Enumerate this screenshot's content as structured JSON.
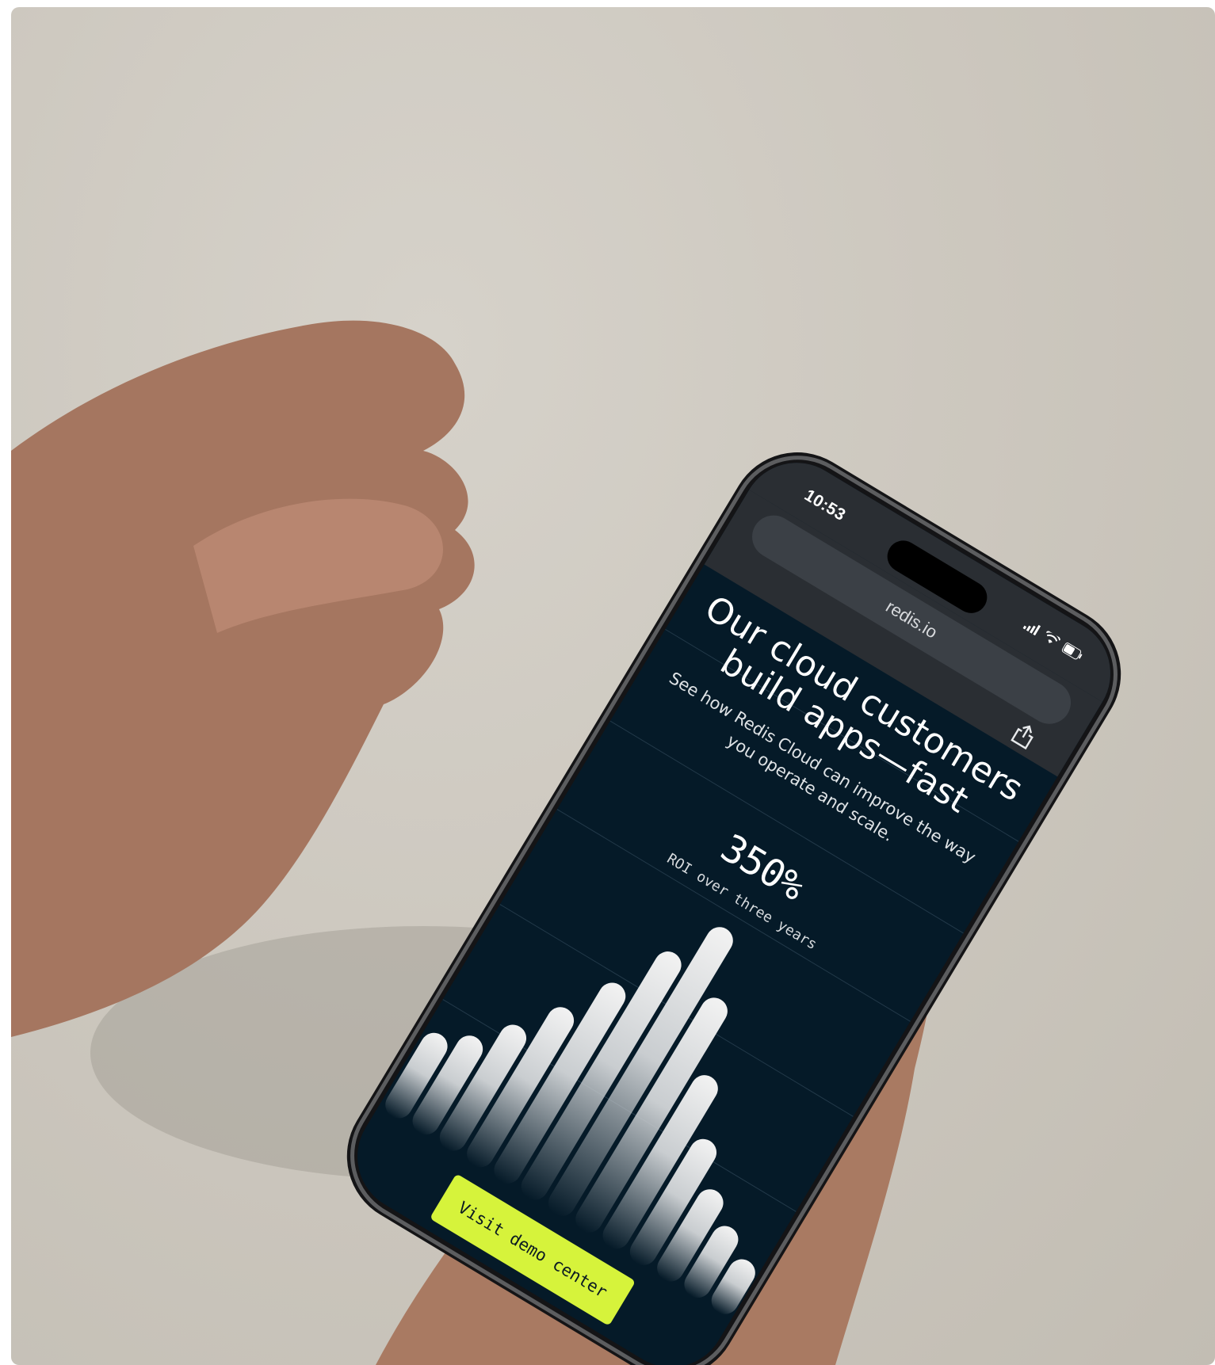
{
  "status_bar": {
    "time": "10:53",
    "icons": [
      "signal-icon",
      "wifi-icon",
      "battery-icon"
    ]
  },
  "browser": {
    "url": "redis.io",
    "share_icon": "share-icon"
  },
  "hero": {
    "title": "Our cloud customers build apps—fast",
    "subtitle": "See how Redis Cloud can improve the way you operate and scale."
  },
  "stat": {
    "value": "350%",
    "label": "ROI over three years"
  },
  "cta": {
    "label": "Visit demo center"
  },
  "colors": {
    "screen_background": "#051a28",
    "cta_background": "#d6f33b",
    "bar_color": "#f2f2f2",
    "browser_chrome": "#2a2e33"
  }
}
